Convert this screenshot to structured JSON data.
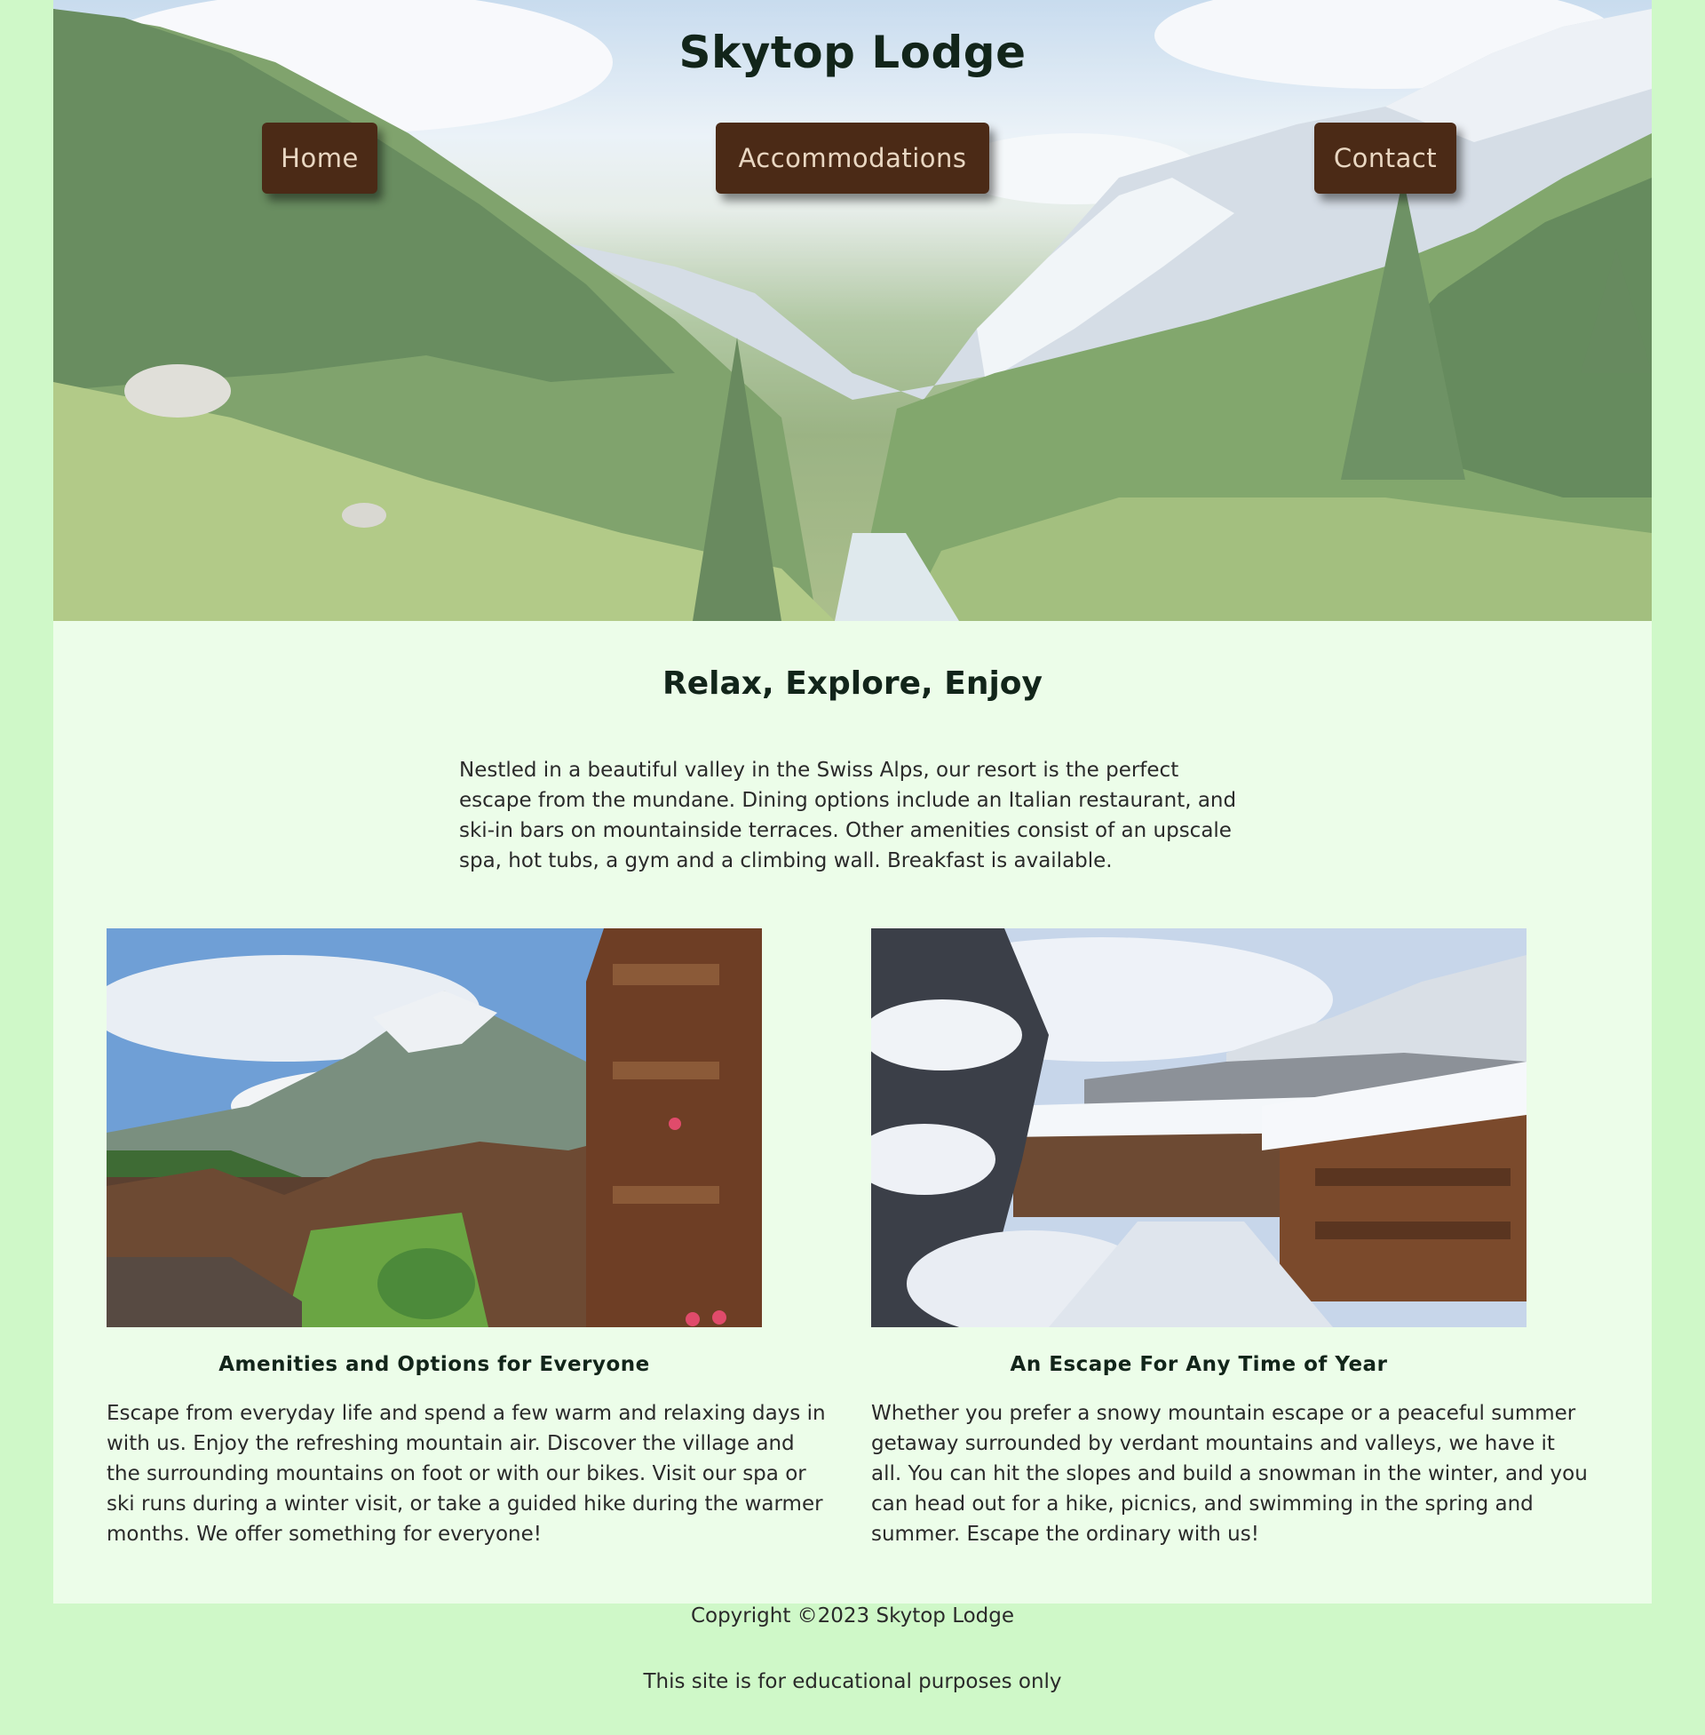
{
  "header": {
    "title": "Skytop Lodge",
    "nav": {
      "home": "Home",
      "accommodations": "Accommodations",
      "contact": "Contact"
    },
    "hero_image": "alpine-valley-photo"
  },
  "main": {
    "heading": "Relax, Explore, Enjoy",
    "intro": "Nestled in a beautiful valley in the Swiss Alps, our resort is the perfect escape from the mundane. Dining options include an Italian restaurant, and ski-in bars on mountainside terraces. Other amenities consist of an upscale spa, hot tubs, a gym and a climbing wall. Breakfast is available.",
    "cards": [
      {
        "image": "summer-village-photo",
        "title": "Amenities and Options for Everyone",
        "text": "Escape from everyday life and spend a few warm and relaxing days in with us. Enjoy the refreshing mountain air. Discover the village and the surrounding mountains on foot or with our bikes. Visit our spa or ski runs during a winter visit, or take a guided hike during the warmer months. We offer something for everyone!"
      },
      {
        "image": "winter-village-photo",
        "title": "An Escape For Any Time of Year",
        "text": "Whether you prefer a snowy mountain escape or a peaceful summer getaway surrounded by verdant mountains and valleys, we have it all. You can hit the slopes and build a snowman in the winter, and you can head out for a hike, picnics, and swimming in the spring and summer. Escape the ordinary with us!"
      }
    ]
  },
  "footer": {
    "copyright": "Copyright ©2023 Skytop Lodge",
    "note": "This site is for educational purposes only"
  },
  "colors": {
    "page_bg": "#cff8c8",
    "content_bg": "#ecfde9",
    "nav_button_bg": "#4b2a16",
    "nav_button_text": "#e9d7c2",
    "heading_text": "#12251a"
  }
}
